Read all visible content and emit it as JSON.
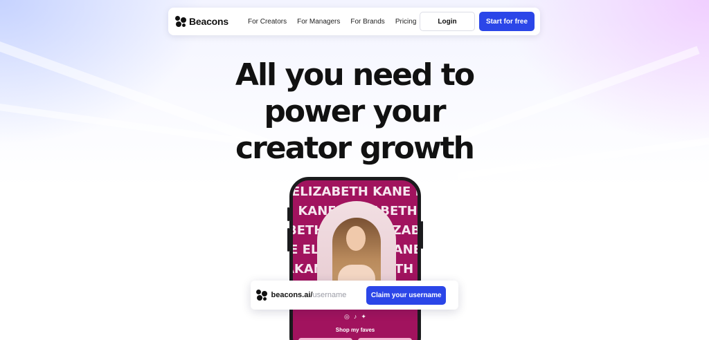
{
  "nav": {
    "brand": "Beacons",
    "links": [
      "For Creators",
      "For Managers",
      "For Brands",
      "Pricing"
    ],
    "login_label": "Login",
    "start_label": "Start for free"
  },
  "hero": {
    "lines": [
      "All you need to",
      "power your",
      "creator growth"
    ]
  },
  "phone": {
    "marquee": [
      "ELIZABETH KANE ELI",
      "H KANE ELIZABETH KA",
      "BETH KANE ELIZABETH",
      "NE ELIZABETH KANE ELI",
      "AKANE ELIZABETH KANE"
    ],
    "icons": [
      "instagram-icon",
      "tiktok-icon",
      "twitter-icon"
    ],
    "shop_label": "Shop my faves"
  },
  "claim": {
    "domain": "beacons.ai/",
    "placeholder": "username",
    "button_label": "Claim your username"
  },
  "colors": {
    "accent": "#2b46e8",
    "phone_bg": "#a1135e"
  }
}
